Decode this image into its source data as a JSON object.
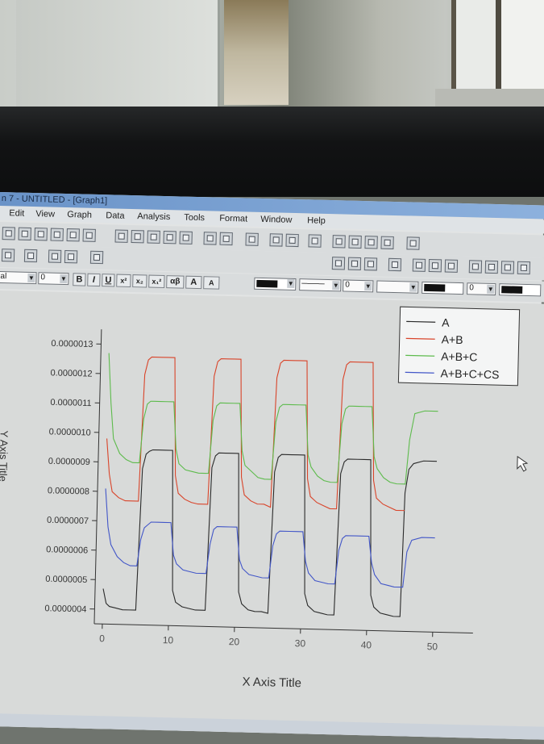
{
  "window": {
    "title": "n 7 - UNTITLED - [Graph1]"
  },
  "menu": [
    "Edit",
    "View",
    "Graph",
    "Data",
    "Analysis",
    "Tools",
    "Format",
    "Window",
    "Help"
  ],
  "format_toolbar": {
    "font": "al",
    "size": "0",
    "bold": "B",
    "italic": "I",
    "underline": "U",
    "superscript": "x²",
    "subscript": "x₂",
    "supsub": "x₁²",
    "greek": "αβ",
    "grow": "A",
    "shrink": "A",
    "line_width": "0",
    "pattern": "0",
    "border": "0"
  },
  "chart_data": {
    "type": "line",
    "xlabel": "X Axis Title",
    "ylabel": "Y Axis Title",
    "xlim": [
      0,
      50
    ],
    "ylim": [
      3.5e-07,
      1.35e-06
    ],
    "x_ticks": [
      0,
      10,
      20,
      30,
      40,
      50
    ],
    "y_tick_values": [
      4e-07,
      5e-07,
      6e-07,
      7e-07,
      8e-07,
      9e-07,
      1e-06,
      1.1e-06,
      1.2e-06,
      1.3e-06
    ],
    "y_tick_labels": [
      "0.0000004",
      "0.0000005",
      "0.0000006",
      "0.0000007",
      "0.0000008",
      "0.0000009",
      "0.0000010",
      "0.0000011",
      "0.0000012",
      "0.0000013"
    ],
    "legend_position": "top-right",
    "x": [
      0,
      0.5,
      1,
      2,
      3,
      4,
      5,
      5.5,
      6,
      6.5,
      7,
      8,
      9,
      10,
      10.5,
      11,
      12,
      13,
      14,
      15,
      15.5,
      16,
      16.5,
      17,
      18,
      19,
      20,
      20.5,
      21,
      22,
      23,
      24,
      25,
      25.5,
      26,
      26.5,
      27,
      28,
      29,
      30,
      30.5,
      31,
      32,
      33,
      34,
      35,
      35.5,
      36,
      36.5,
      37,
      38,
      39,
      40,
      40.5,
      41,
      42,
      43,
      44,
      45,
      45.3,
      45.8,
      46.5,
      48,
      50
    ],
    "series": [
      {
        "name": "A",
        "color": "#2a2a2a",
        "values": [
          4.7e-07,
          4.2e-07,
          4.1e-07,
          4.05e-07,
          4e-07,
          4e-07,
          4e-07,
          8.8e-07,
          9.3e-07,
          9.4e-07,
          9.45e-07,
          9.45e-07,
          9.45e-07,
          9.45e-07,
          4.7e-07,
          4.3e-07,
          4.15e-07,
          4.1e-07,
          4.05e-07,
          4.05e-07,
          4.05e-07,
          8.9e-07,
          9.3e-07,
          9.4e-07,
          9.4e-07,
          9.4e-07,
          9.4e-07,
          4.7e-07,
          4.3e-07,
          4.1e-07,
          4.05e-07,
          4.05e-07,
          4e-07,
          8.8e-07,
          9.3e-07,
          9.4e-07,
          9.4e-07,
          9.4e-07,
          9.4e-07,
          9.4e-07,
          4.7e-07,
          4.3e-07,
          4.1e-07,
          4.05e-07,
          4e-07,
          4e-07,
          8.8e-07,
          9.2e-07,
          9.3e-07,
          9.3e-07,
          9.3e-07,
          9.3e-07,
          9.3e-07,
          4.7e-07,
          4.3e-07,
          4.1e-07,
          4.05e-07,
          4e-07,
          4e-07,
          8.2e-07,
          9e-07,
          9.2e-07,
          9.3e-07,
          9.3e-07
        ]
      },
      {
        "name": "A+B",
        "color": "#d9442a",
        "values": [
          9.8e-07,
          8.6e-07,
          8e-07,
          7.8e-07,
          7.7e-07,
          7.7e-07,
          7.7e-07,
          1.2e-06,
          1.25e-06,
          1.26e-06,
          1.26e-06,
          1.26e-06,
          1.26e-06,
          1.26e-06,
          8.6e-07,
          8e-07,
          7.8e-07,
          7.7e-07,
          7.65e-07,
          7.65e-07,
          7.65e-07,
          1.2e-06,
          1.25e-06,
          1.26e-06,
          1.26e-06,
          1.26e-06,
          1.26e-06,
          8.6e-07,
          8e-07,
          7.8e-07,
          7.7e-07,
          7.7e-07,
          7.6e-07,
          1.2e-06,
          1.25e-06,
          1.26e-06,
          1.26e-06,
          1.26e-06,
          1.26e-06,
          1.26e-06,
          8.6e-07,
          8e-07,
          7.8e-07,
          7.7e-07,
          7.6e-07,
          7.6e-07,
          1.2e-06,
          1.25e-06,
          1.26e-06,
          1.26e-06,
          1.26e-06,
          1.26e-06,
          1.26e-06,
          8.6e-07,
          8e-07,
          7.8e-07,
          7.7e-07,
          7.6e-07,
          7.6e-07,
          7.6e-07,
          null,
          null,
          null,
          null
        ]
      },
      {
        "name": "A+B+C",
        "color": "#5dbb4c",
        "values": [
          1.27e-06,
          1.1e-06,
          9.8e-07,
          9.3e-07,
          9.1e-07,
          9e-07,
          9e-07,
          1.05e-06,
          1.1e-06,
          1.11e-06,
          1.11e-06,
          1.11e-06,
          1.11e-06,
          1.11e-06,
          9.5e-07,
          9e-07,
          8.8e-07,
          8.75e-07,
          8.7e-07,
          8.7e-07,
          8.7e-07,
          1.05e-06,
          1.1e-06,
          1.11e-06,
          1.11e-06,
          1.11e-06,
          1.11e-06,
          9.5e-07,
          9e-07,
          8.8e-07,
          8.6e-07,
          8.55e-07,
          8.55e-07,
          1.05e-06,
          1.1e-06,
          1.11e-06,
          1.11e-06,
          1.11e-06,
          1.11e-06,
          1.11e-06,
          9.4e-07,
          9e-07,
          8.7e-07,
          8.55e-07,
          8.5e-07,
          8.5e-07,
          1.05e-06,
          1.1e-06,
          1.11e-06,
          1.11e-06,
          1.11e-06,
          1.11e-06,
          1.11e-06,
          9.4e-07,
          9e-07,
          8.7e-07,
          8.55e-07,
          8.5e-07,
          8.5e-07,
          8.5e-07,
          1e-06,
          1.09e-06,
          1.1e-06,
          1.1e-06
        ]
      },
      {
        "name": "A+B+C+CS",
        "color": "#4256c8",
        "values": [
          8.1e-07,
          6.8e-07,
          6.2e-07,
          5.8e-07,
          5.6e-07,
          5.5e-07,
          5.5e-07,
          6.4e-07,
          6.8e-07,
          6.9e-07,
          7e-07,
          7e-07,
          7e-07,
          7e-07,
          5.9e-07,
          5.6e-07,
          5.4e-07,
          5.35e-07,
          5.3e-07,
          5.3e-07,
          5.3e-07,
          6.3e-07,
          6.8e-07,
          6.9e-07,
          6.9e-07,
          6.9e-07,
          6.9e-07,
          5.8e-07,
          5.5e-07,
          5.3e-07,
          5.25e-07,
          5.2e-07,
          5.2e-07,
          6.3e-07,
          6.7e-07,
          6.8e-07,
          6.8e-07,
          6.8e-07,
          6.8e-07,
          6.8e-07,
          5.8e-07,
          5.4e-07,
          5.15e-07,
          5.1e-07,
          5.05e-07,
          5.05e-07,
          6.2e-07,
          6.6e-07,
          6.7e-07,
          6.7e-07,
          6.7e-07,
          6.7e-07,
          6.7e-07,
          5.8e-07,
          5.4e-07,
          5.1e-07,
          5.05e-07,
          5e-07,
          5e-07,
          5e-07,
          6.2e-07,
          6.6e-07,
          6.7e-07,
          6.7e-07
        ]
      }
    ]
  }
}
